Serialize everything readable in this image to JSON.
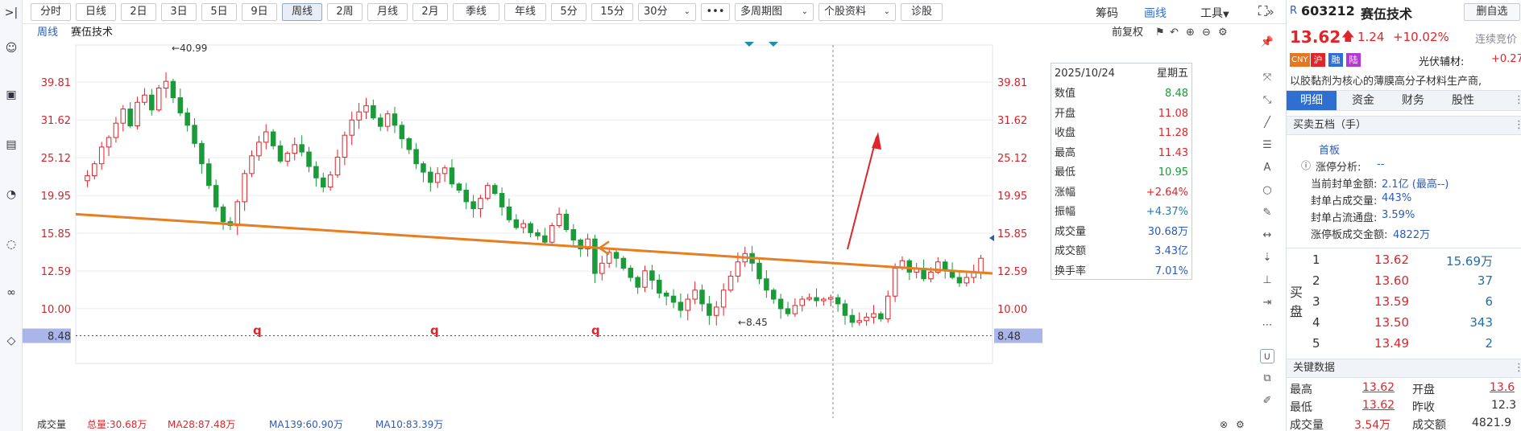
{
  "toolbar": {
    "periods": [
      "分时",
      "日线",
      "2日",
      "3日",
      "5日",
      "9日",
      "周线",
      "2周",
      "月线",
      "2月",
      "季线",
      "年线",
      "5分",
      "15分",
      "30分"
    ],
    "active_period": "周线",
    "more_label": "•••",
    "multi_period": "多周期图",
    "stock_info": "个股资料",
    "diagnose": "诊股",
    "chips": "筹码",
    "draw": "画线",
    "tools": "工具"
  },
  "subheader": {
    "period": "周线",
    "stock_name": "赛伍技术",
    "adjust": "前复权"
  },
  "chart_data": {
    "type": "candlestick",
    "title": "赛伍技术 周线",
    "y_ticks": [
      "39.81",
      "31.62",
      "25.12",
      "19.95",
      "15.85",
      "12.59",
      "10.00",
      "8.48"
    ],
    "y_tick_values": [
      39.81,
      31.62,
      25.12,
      19.95,
      15.85,
      12.59,
      10.0,
      8.48
    ],
    "scale": "log",
    "ylim": [
      7.9,
      48
    ],
    "high_label": "40.99",
    "low_label": "8.45",
    "current_line_label": "8.48",
    "q_markers": [
      "q",
      "q",
      "q"
    ],
    "trendline": {
      "start": 17.8,
      "end": 12.4,
      "color": "#e67e22"
    },
    "close_series": [
      22.5,
      24.2,
      26.8,
      28.4,
      31.0,
      33.8,
      30.5,
      35.2,
      36.8,
      33.6,
      38.4,
      40.0,
      36.2,
      33.0,
      30.6,
      27.4,
      24.2,
      21.2,
      18.6,
      17.0,
      16.6,
      19.2,
      22.8,
      25.4,
      27.6,
      29.4,
      27.0,
      24.6,
      25.8,
      27.2,
      26.0,
      23.8,
      22.2,
      21.0,
      22.6,
      25.2,
      28.8,
      31.6,
      33.2,
      34.5,
      32.0,
      30.4,
      32.8,
      30.6,
      28.2,
      26.4,
      24.2,
      23.0,
      21.6,
      22.8,
      23.6,
      21.4,
      20.6,
      19.2,
      18.4,
      19.6,
      21.2,
      20.2,
      18.6,
      17.2,
      16.4,
      16.8,
      15.9,
      15.6,
      15.0,
      16.6,
      17.8,
      16.2,
      15.2,
      14.4,
      15.3,
      12.4,
      13.2,
      14.1,
      13.6,
      12.8,
      12.1,
      11.4,
      12.6,
      11.9,
      11.0,
      10.8,
      10.4,
      9.9,
      10.6,
      11.2,
      10.3,
      9.6,
      10.1,
      11.2,
      12.2,
      13.3,
      14.0,
      13.2,
      12.0,
      11.2,
      10.6,
      10.0,
      9.7,
      10.2,
      10.6,
      10.7,
      10.5,
      10.6,
      10.7,
      10.3,
      9.6,
      9.2,
      9.3,
      9.5,
      9.7,
      9.4,
      10.8,
      12.8,
      13.4,
      12.5,
      12.8,
      12.0,
      12.5,
      13.3,
      12.6,
      12.1,
      11.7,
      12.1,
      12.5,
      13.6
    ],
    "annotations": [
      "40.99",
      "8.45"
    ],
    "grid": true,
    "legend_position": "bottom-left"
  },
  "tooltip": {
    "date": "2025/10/24",
    "weekday": "星期五",
    "rows": [
      {
        "label": "数值",
        "value": "8.48",
        "color": "#1a9a39"
      },
      {
        "label": "开盘",
        "value": "11.08",
        "color": "#e0252a"
      },
      {
        "label": "收盘",
        "value": "11.28",
        "color": "#e0252a"
      },
      {
        "label": "最高",
        "value": "11.43",
        "color": "#e0252a"
      },
      {
        "label": "最低",
        "value": "10.95",
        "color": "#1a9a39"
      },
      {
        "label": "涨幅",
        "value": "+2.64%",
        "color": "#e0252a"
      },
      {
        "label": "振幅",
        "value": "+4.37%",
        "color": "#1f7fae"
      },
      {
        "label": "成交量",
        "value": "30.68万",
        "color": "#2d5bb8"
      },
      {
        "label": "成交额",
        "value": "3.43亿",
        "color": "#2d5bb8"
      },
      {
        "label": "换手率",
        "value": "7.01%",
        "color": "#2d5bb8"
      }
    ]
  },
  "bottom": {
    "label": "成交量",
    "total": "总量:30.68万",
    "ma28": "MA28:87.48万",
    "ma139": "MA139:60.90万",
    "ma10": "MA10:83.39万"
  },
  "panel": {
    "code_prefix": "R",
    "code": "603212",
    "name": "赛伍技术",
    "remove_fav": "删自选",
    "price": "13.62",
    "change": "1.24",
    "change_pct": "+10.02%",
    "streak": "连续竞价",
    "badges": [
      "CNY",
      "沪",
      "融",
      "陆"
    ],
    "sector": "光伏辅材:",
    "sector_chg": "+0.27",
    "description": "以胶黏剂为核心的薄膜高分子材料生产商,",
    "tabs": [
      "明细",
      "资金",
      "财务",
      "股性"
    ],
    "active_tab": "明细",
    "five_levels_title": "买卖五档（手）",
    "first_board": "首板",
    "limit_analysis_label": "涨停分析:",
    "limit_analysis_value": "--",
    "limit_items": [
      {
        "label": "当前封单金额:",
        "value": "2.1亿 (最高--)"
      },
      {
        "label": "封单占成交量:",
        "value": "443%"
      },
      {
        "label": "封单占流通盘:",
        "value": "3.59%"
      },
      {
        "label": "涨停板成交金额:",
        "value": "4822万"
      }
    ],
    "buy_label_1": "买",
    "buy_label_2": "盘",
    "bids": [
      {
        "level": "1",
        "price": "13.62",
        "vol": "15.69万"
      },
      {
        "level": "2",
        "price": "13.60",
        "vol": "37"
      },
      {
        "level": "3",
        "price": "13.59",
        "vol": "6"
      },
      {
        "level": "4",
        "price": "13.50",
        "vol": "343"
      },
      {
        "level": "5",
        "price": "13.49",
        "vol": "2"
      }
    ],
    "key_data_title": "关键数据",
    "key": {
      "high_label": "最高",
      "high": "13.62",
      "open_label": "开盘",
      "open": "13.6",
      "low_label": "最低",
      "low": "13.62",
      "prev_label": "昨收",
      "prev": "12.3",
      "vol_label": "成交量",
      "vol": "3.54万",
      "amt_label": "成交额",
      "amt": "4821.9"
    }
  },
  "colors": {
    "up": "#e0252a",
    "down": "#1a9a39",
    "trend": "#e67e22",
    "accent": "#2d5bb8"
  }
}
